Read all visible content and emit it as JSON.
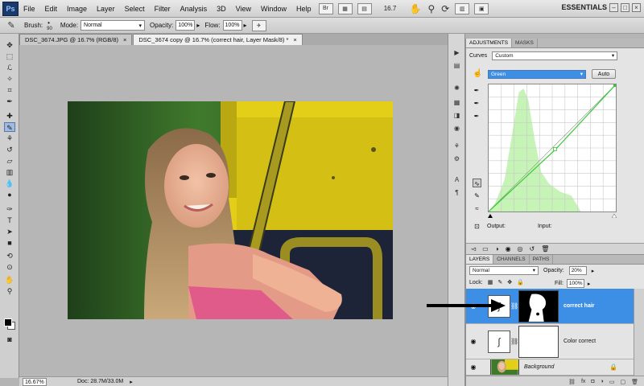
{
  "menubar": {
    "logo": "Ps",
    "items": [
      "File",
      "Edit",
      "Image",
      "Layer",
      "Select",
      "Filter",
      "Analysis",
      "3D",
      "View",
      "Window",
      "Help"
    ],
    "bridge_label": "Br",
    "zoom_value": "16.7",
    "workspace": "ESSENTIALS",
    "icons": [
      "bridge-icon",
      "minibridge-icon",
      "hand-tool-icon",
      "zoom-tool-icon",
      "rotate-view-icon",
      "arrange-documents-icon",
      "screen-mode-icon"
    ]
  },
  "options": {
    "brush_label": "Brush:",
    "brush_size": "90",
    "mode_label": "Mode:",
    "mode_value": "Normal",
    "opacity_label": "Opacity:",
    "opacity_value": "100%",
    "flow_label": "Flow:",
    "flow_value": "100%"
  },
  "doc_tabs": [
    {
      "label": "DSC_3674.JPG @ 16.7% (RGB/8)",
      "close": "×"
    },
    {
      "label": "DSC_3674 copy @ 16.7% (correct hair, Layer Mask/8) *",
      "close": "×"
    }
  ],
  "status": {
    "zoom": "16.67%",
    "doc_info": "Doc: 28.7M/33.0M"
  },
  "adjustments": {
    "tabs": [
      "ADJUSTMENTS",
      "MASKS"
    ],
    "type_label": "Curves",
    "preset_value": "Custom",
    "channel_value": "Green",
    "auto_label": "Auto",
    "output_label": "Output:",
    "input_label": "Input:"
  },
  "layers": {
    "tabs": [
      "LAYERS",
      "CHANNELS",
      "PATHS"
    ],
    "blend_mode": "Normal",
    "opacity_label": "Opacity:",
    "opacity_value": "20%",
    "lock_label": "Lock:",
    "fill_label": "Fill:",
    "fill_value": "100%",
    "rows": [
      {
        "name": "correct hair",
        "selected": true
      },
      {
        "name": "Color correct",
        "selected": false
      },
      {
        "name": "Background",
        "selected": false
      }
    ],
    "footer_icons": [
      "link-layers-icon",
      "fx-icon",
      "add-mask-icon",
      "new-adjustment-icon",
      "new-group-icon",
      "new-layer-icon",
      "trash-icon"
    ],
    "footer_fx": "fx"
  },
  "colors": {
    "selection_blue": "#3d8fe6",
    "curve_green": "#2ecc2e",
    "histogram_green": "#c6f3b6",
    "panel_gray": "#e4e4e4",
    "canvas_gray": "#b6b6b6"
  }
}
